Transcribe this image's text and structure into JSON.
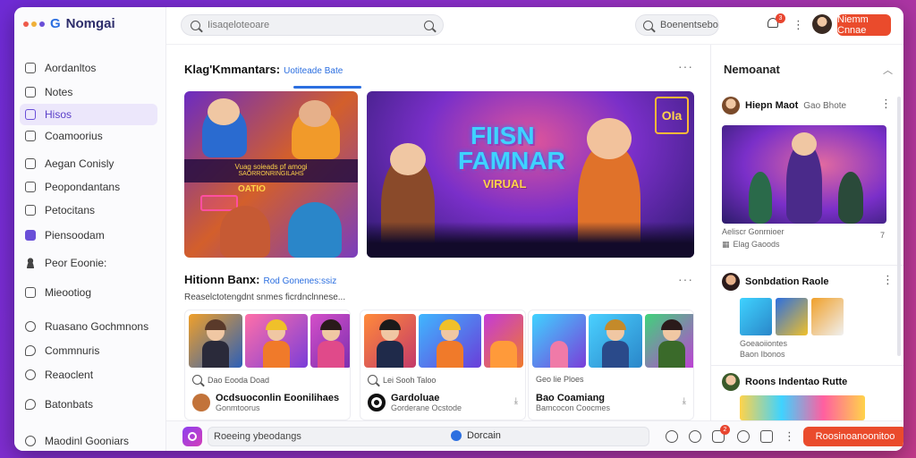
{
  "app": {
    "title": "Nomgai",
    "logo_letter": "G"
  },
  "colors": {
    "accent": "#2c6fe0",
    "primary_button": "#ea4b2c",
    "active_nav": "#ece7fb",
    "purple": "#6a4fd8"
  },
  "sidebar": {
    "items": [
      {
        "label": "Aordanltos",
        "icon": "square-icon"
      },
      {
        "label": "Notes",
        "icon": "square-icon"
      },
      {
        "label": "Hisos",
        "icon": "square-icon",
        "active": true
      },
      {
        "label": "Coamoorius",
        "icon": "square-icon"
      },
      {
        "label": "Aegan Conisly",
        "icon": "square-icon"
      },
      {
        "label": "Peopondantans",
        "icon": "square-icon"
      },
      {
        "label": "Petocitans",
        "icon": "square-icon"
      },
      {
        "label": "Piensoodam",
        "icon": "bag-icon"
      },
      {
        "label": "Peor Eoonie:",
        "icon": "person-icon"
      },
      {
        "label": "Mieootiog",
        "icon": "square-icon"
      },
      {
        "label": "Ruasano Gochmnons",
        "icon": "circle-icon"
      },
      {
        "label": "Commnuris",
        "icon": "bubble-icon"
      },
      {
        "label": "Reaoclent",
        "icon": "circle-icon"
      },
      {
        "label": "Batonbats",
        "icon": "bubble-icon"
      },
      {
        "label": "Maodinl Gooniars",
        "icon": "circle-icon"
      }
    ]
  },
  "topbar": {
    "search_placeholder": "Iisaqeloteoare",
    "search2_label": "Boenentsebo",
    "notification_count": "3",
    "primary_button": "Niemm Cnnae"
  },
  "main": {
    "featured": {
      "title": "Klag'Kmmantars:",
      "subtitle": "Uotiteade Bate"
    },
    "hero_left": {
      "band_text": "Vuag soieads pf amogi",
      "band_subtext": "SAORRONRINGILAHS",
      "sign_text": "OATIO"
    },
    "hero": {
      "title_line1": "FIISN",
      "title_line2": "FAMNAR",
      "subtitle": "VIRUAL",
      "neon_text": "OIa"
    },
    "trending": {
      "title": "Hitionn Banx:",
      "subtitle": "Rod Gonenes:ssiz",
      "description": "Reaselctotengdnt snmes ficrdnclnnese..."
    },
    "cards": [
      {
        "meta": "Dao Eooda Doad",
        "title": "Ocdsuoconlin Eoonilihaes",
        "subtitle": "Gonmtoorus",
        "avatar_color": "#c2733a"
      },
      {
        "meta": "Lei Sooh Taloo",
        "title": "Gardoluae",
        "subtitle": "Gorderane Ocstode",
        "avatar_color": "#111111"
      },
      {
        "meta": "Geo lie Ploes",
        "title": "Bao Coamiang",
        "subtitle": "Bamcocon Coocmes",
        "avatar_color": "#ffffff"
      }
    ]
  },
  "right_panel": {
    "title": "Nemoanat",
    "items": [
      {
        "name": "Hiepn Maot",
        "sub": "Gao Bhote",
        "meta_line1": "Aeliscr Gonrnioer",
        "meta_line2": "Elag Gaoods",
        "indicator": "7"
      },
      {
        "name": "Sonbdation Raole",
        "sub": "",
        "meta_line1": "Goeaoiiontes",
        "meta_line2": "Baon Ibonos"
      },
      {
        "name": "Roons Indentao Rutte",
        "sub": ""
      }
    ]
  },
  "bottombar": {
    "input_text": "Roeeing ybeodangs",
    "chip_label": "Dorcain",
    "notification_count": "2",
    "primary_button": "Roosinoanoonitoo"
  }
}
